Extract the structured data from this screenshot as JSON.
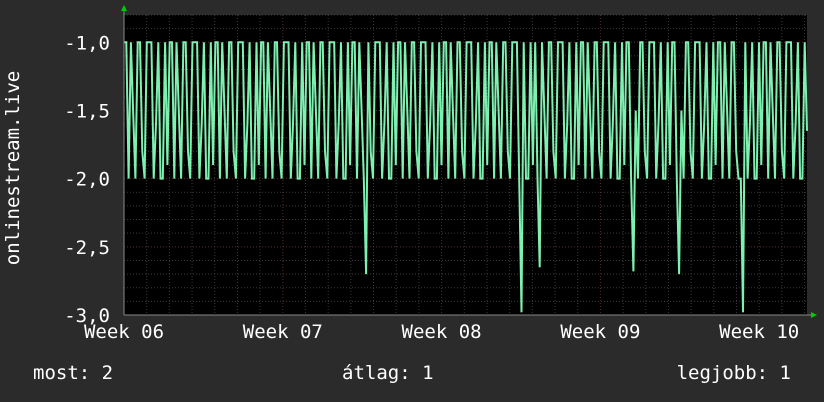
{
  "colors": {
    "background": "#2b2b2b",
    "plot_background": "#000000",
    "series": "#7ef0b0",
    "grid_minor": "#3a3a3a",
    "grid_major": "#5a2a2a",
    "axis_arrow": "#00cc00",
    "text": "#ffffff"
  },
  "stats": {
    "current_label": "most:",
    "current_value": "2",
    "average_label": "átlag:",
    "average_value": "1",
    "best_label": "legjobb:",
    "best_value": "1"
  },
  "chart_data": {
    "type": "line",
    "title": "",
    "xlabel": "",
    "ylabel": "onlinestream.live",
    "ylim": [
      -3.0,
      -0.8
    ],
    "xlim": [
      0,
      100
    ],
    "grid": true,
    "x_ticks": [
      {
        "x": 0,
        "label": "Week 06"
      },
      {
        "x": 23.25,
        "label": "Week 07"
      },
      {
        "x": 46.5,
        "label": "Week 08"
      },
      {
        "x": 69.75,
        "label": "Week 09"
      },
      {
        "x": 93,
        "label": "Week 10"
      }
    ],
    "y_ticks": [
      {
        "y": -1.0,
        "label": "-1,0"
      },
      {
        "y": -1.5,
        "label": "-1,5"
      },
      {
        "y": -2.0,
        "label": "-2,0"
      },
      {
        "y": -2.5,
        "label": "-2,5"
      },
      {
        "y": -3.0,
        "label": "-3,0"
      }
    ],
    "series": [
      {
        "color": "#7ef0b0",
        "pattern": [
          -1.0,
          -1.0,
          -2.0,
          -1.0,
          -1.5,
          -2.0,
          -1.0,
          -1.0,
          -1.8,
          -2.0,
          -1.0,
          -1.0,
          -1.0,
          -2.0,
          -1.6,
          -1.0,
          -2.0,
          -2.0,
          -1.0,
          -1.9
        ],
        "dips": [
          {
            "x": 35.4,
            "y": -2.7
          },
          {
            "x": 58.2,
            "y": -2.98
          },
          {
            "x": 61.0,
            "y": -2.65
          },
          {
            "x": 74.5,
            "y": -2.68
          },
          {
            "x": 81.2,
            "y": -2.7
          },
          {
            "x": 90.8,
            "y": -2.98
          }
        ],
        "last_value": -1.65
      }
    ]
  }
}
